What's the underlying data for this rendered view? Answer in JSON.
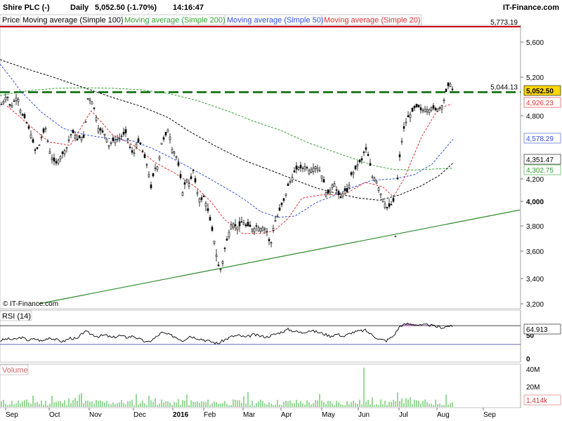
{
  "header": {
    "symbol": "Shire PLC (-)",
    "period": "Daily",
    "price_change": "5,052.50 (-1.70%)",
    "time": "14:16:47",
    "brand": "IT-Finance.com"
  },
  "legend": {
    "price": "Price",
    "ma100": "Moving average (Simple 100)",
    "ma200": "Moving average (Simple 200)",
    "ma50": "Moving average (Simple 50)",
    "ma20": "Moving average (Simple 20)"
  },
  "copyright": "© IT-Finance.com",
  "rsi_label": "RSI (14)",
  "volume_label": "Volume",
  "colors": {
    "up": "#000000",
    "down": "#000000",
    "ma20": "#e03030",
    "ma50": "#3050e0",
    "ma100": "#000000",
    "ma200": "#30a030",
    "resistance": "#cc0000",
    "support_dash": "#006600",
    "trend": "#2a8a2a",
    "rsi_line": "#000000",
    "rsi_fill": "#c080d0",
    "vol": "#30b030"
  },
  "chart_data": {
    "type": "candlestick",
    "x_tick_labels": [
      "Sep",
      "Oct",
      "Nov",
      "Dec",
      "2016",
      "Feb",
      "Mar",
      "Apr",
      "May",
      "Jun",
      "Jul",
      "Aug",
      "Sep"
    ],
    "price_axis_ticks": [
      "5,600",
      "5,200",
      "4,800",
      "4,200",
      "4,000",
      "3,800",
      "3,600",
      "3,400",
      "3,200"
    ],
    "price_range": [
      3180,
      5820
    ],
    "last_price": "5,052.50",
    "level_labels": {
      "high": "5,773.19",
      "dashed": "5,044.13",
      "ma20": "4,926.23",
      "ma50": "4,578.29",
      "ma100": "4,351.47",
      "ma200": "4,302.75"
    },
    "resistance": 5773.19,
    "dashed_level": 5044.13,
    "price_keypoints": [
      [
        0,
        4900
      ],
      [
        5,
        4950
      ],
      [
        10,
        5020
      ],
      [
        15,
        4880
      ],
      [
        20,
        4950
      ],
      [
        25,
        5010
      ],
      [
        30,
        4820
      ],
      [
        35,
        4780
      ],
      [
        40,
        4700
      ],
      [
        45,
        4600
      ],
      [
        50,
        4470
      ],
      [
        55,
        4500
      ],
      [
        60,
        4620
      ],
      [
        65,
        4680
      ],
      [
        70,
        4480
      ],
      [
        75,
        4380
      ],
      [
        80,
        4350
      ],
      [
        85,
        4400
      ],
      [
        90,
        4450
      ],
      [
        95,
        4500
      ],
      [
        100,
        4620
      ],
      [
        105,
        4640
      ],
      [
        110,
        4570
      ],
      [
        115,
        4600
      ],
      [
        120,
        4590
      ],
      [
        125,
        4980
      ],
      [
        130,
        4970
      ],
      [
        135,
        4850
      ],
      [
        140,
        4680
      ],
      [
        145,
        4650
      ],
      [
        150,
        4620
      ],
      [
        155,
        4520
      ],
      [
        160,
        4560
      ],
      [
        165,
        4570
      ],
      [
        170,
        4590
      ],
      [
        175,
        4620
      ],
      [
        180,
        4640
      ],
      [
        185,
        4500
      ],
      [
        190,
        4420
      ],
      [
        195,
        4560
      ],
      [
        200,
        4530
      ],
      [
        205,
        4420
      ],
      [
        210,
        4320
      ],
      [
        215,
        4120
      ],
      [
        220,
        4300
      ],
      [
        225,
        4320
      ],
      [
        230,
        4540
      ],
      [
        235,
        4600
      ],
      [
        240,
        4680
      ],
      [
        245,
        4480
      ],
      [
        250,
        4440
      ],
      [
        255,
        4300
      ],
      [
        260,
        4080
      ],
      [
        265,
        4200
      ],
      [
        270,
        4150
      ],
      [
        275,
        4280
      ],
      [
        280,
        4100
      ],
      [
        285,
        4000
      ],
      [
        290,
        4040
      ],
      [
        295,
        3950
      ],
      [
        300,
        3820
      ],
      [
        305,
        3680
      ],
      [
        310,
        3500
      ],
      [
        315,
        3460
      ],
      [
        320,
        3620
      ],
      [
        325,
        3730
      ],
      [
        330,
        3830
      ],
      [
        335,
        3800
      ],
      [
        340,
        3790
      ],
      [
        345,
        3840
      ],
      [
        350,
        3800
      ],
      [
        355,
        3800
      ],
      [
        360,
        3770
      ],
      [
        365,
        3800
      ],
      [
        370,
        3780
      ],
      [
        375,
        3790
      ],
      [
        380,
        3760
      ],
      [
        385,
        3630
      ],
      [
        390,
        3820
      ],
      [
        395,
        3880
      ],
      [
        400,
        3960
      ],
      [
        405,
        4020
      ],
      [
        410,
        4140
      ],
      [
        415,
        4200
      ],
      [
        420,
        4280
      ],
      [
        425,
        4310
      ],
      [
        430,
        4300
      ],
      [
        435,
        4320
      ],
      [
        440,
        4280
      ],
      [
        445,
        4300
      ],
      [
        450,
        4320
      ],
      [
        455,
        4280
      ],
      [
        460,
        4200
      ],
      [
        465,
        4050
      ],
      [
        470,
        4100
      ],
      [
        475,
        4180
      ],
      [
        480,
        4080
      ],
      [
        485,
        4030
      ],
      [
        490,
        4100
      ],
      [
        495,
        4080
      ],
      [
        500,
        4240
      ],
      [
        505,
        4280
      ],
      [
        510,
        4350
      ],
      [
        515,
        4380
      ],
      [
        520,
        4500
      ],
      [
        525,
        4400
      ],
      [
        530,
        4220
      ],
      [
        535,
        4200
      ],
      [
        540,
        4100
      ],
      [
        545,
        4020
      ],
      [
        550,
        3950
      ],
      [
        555,
        3960
      ],
      [
        560,
        4000
      ],
      [
        563,
        3720
      ],
      [
        566,
        4200
      ],
      [
        570,
        4480
      ],
      [
        575,
        4680
      ],
      [
        580,
        4780
      ],
      [
        585,
        4820
      ],
      [
        590,
        4880
      ],
      [
        595,
        4900
      ],
      [
        600,
        4850
      ],
      [
        605,
        4870
      ],
      [
        610,
        4860
      ],
      [
        615,
        4890
      ],
      [
        620,
        4860
      ],
      [
        625,
        4880
      ],
      [
        630,
        4910
      ],
      [
        635,
        5050
      ],
      [
        640,
        5150
      ],
      [
        645,
        5052
      ]
    ],
    "ma20_keypoints": [
      [
        10,
        4900
      ],
      [
        40,
        4720
      ],
      [
        70,
        4550
      ],
      [
        100,
        4520
      ],
      [
        130,
        4850
      ],
      [
        160,
        4620
      ],
      [
        190,
        4520
      ],
      [
        220,
        4360
      ],
      [
        250,
        4250
      ],
      [
        280,
        4120
      ],
      [
        300,
        4000
      ],
      [
        320,
        3850
      ],
      [
        345,
        3740
      ],
      [
        370,
        3740
      ],
      [
        390,
        3760
      ],
      [
        410,
        3860
      ],
      [
        430,
        4030
      ],
      [
        460,
        4060
      ],
      [
        490,
        4060
      ],
      [
        520,
        4170
      ],
      [
        545,
        4130
      ],
      [
        560,
        4040
      ],
      [
        575,
        4200
      ],
      [
        600,
        4600
      ],
      [
        625,
        4880
      ],
      [
        645,
        4926
      ]
    ],
    "ma50_keypoints": [
      [
        0,
        5350
      ],
      [
        30,
        5050
      ],
      [
        60,
        4830
      ],
      [
        90,
        4680
      ],
      [
        120,
        4620
      ],
      [
        160,
        4580
      ],
      [
        190,
        4560
      ],
      [
        220,
        4480
      ],
      [
        250,
        4380
      ],
      [
        280,
        4270
      ],
      [
        310,
        4160
      ],
      [
        340,
        4050
      ],
      [
        370,
        3920
      ],
      [
        395,
        3870
      ],
      [
        420,
        3880
      ],
      [
        450,
        3990
      ],
      [
        475,
        4050
      ],
      [
        500,
        4120
      ],
      [
        530,
        4190
      ],
      [
        560,
        4200
      ],
      [
        590,
        4240
      ],
      [
        615,
        4340
      ],
      [
        645,
        4578
      ]
    ],
    "ma100_keypoints": [
      [
        0,
        5400
      ],
      [
        40,
        5290
      ],
      [
        80,
        5190
      ],
      [
        120,
        5090
      ],
      [
        160,
        4990
      ],
      [
        200,
        4900
      ],
      [
        240,
        4780
      ],
      [
        270,
        4650
      ],
      [
        310,
        4500
      ],
      [
        350,
        4370
      ],
      [
        390,
        4270
      ],
      [
        420,
        4190
      ],
      [
        450,
        4120
      ],
      [
        480,
        4070
      ],
      [
        510,
        4030
      ],
      [
        540,
        4010
      ],
      [
        570,
        4060
      ],
      [
        600,
        4140
      ],
      [
        625,
        4230
      ],
      [
        645,
        4351
      ]
    ],
    "ma200_keypoints": [
      [
        0,
        5010
      ],
      [
        40,
        5060
      ],
      [
        80,
        5085
      ],
      [
        120,
        5090
      ],
      [
        160,
        5085
      ],
      [
        200,
        5070
      ],
      [
        240,
        5030
      ],
      [
        280,
        4960
      ],
      [
        320,
        4860
      ],
      [
        360,
        4750
      ],
      [
        400,
        4660
      ],
      [
        440,
        4540
      ],
      [
        470,
        4470
      ],
      [
        500,
        4400
      ],
      [
        530,
        4330
      ],
      [
        560,
        4290
      ],
      [
        590,
        4285
      ],
      [
        620,
        4295
      ],
      [
        645,
        4302
      ]
    ],
    "trendline": [
      [
        55,
        3200
      ],
      [
        740,
        3930
      ]
    ],
    "rsi": {
      "value": "64.913",
      "axis_ticks": [
        "0",
        "50"
      ],
      "upper": 70,
      "lower": 30,
      "keypoints": [
        [
          0,
          38
        ],
        [
          10,
          42
        ],
        [
          20,
          40
        ],
        [
          30,
          45
        ],
        [
          40,
          39
        ],
        [
          50,
          42
        ],
        [
          60,
          37
        ],
        [
          70,
          45
        ],
        [
          80,
          40
        ],
        [
          90,
          36
        ],
        [
          100,
          44
        ],
        [
          110,
          41
        ],
        [
          120,
          58
        ],
        [
          130,
          52
        ],
        [
          140,
          47
        ],
        [
          150,
          50
        ],
        [
          160,
          44
        ],
        [
          170,
          49
        ],
        [
          180,
          45
        ],
        [
          190,
          48
        ],
        [
          200,
          40
        ],
        [
          210,
          34
        ],
        [
          220,
          43
        ],
        [
          230,
          55
        ],
        [
          240,
          51
        ],
        [
          250,
          46
        ],
        [
          260,
          38
        ],
        [
          270,
          48
        ],
        [
          280,
          44
        ],
        [
          290,
          40
        ],
        [
          300,
          36
        ],
        [
          310,
          32
        ],
        [
          320,
          40
        ],
        [
          330,
          47
        ],
        [
          340,
          49
        ],
        [
          350,
          45
        ],
        [
          360,
          51
        ],
        [
          370,
          48
        ],
        [
          380,
          46
        ],
        [
          390,
          51
        ],
        [
          400,
          56
        ],
        [
          410,
          62
        ],
        [
          420,
          58
        ],
        [
          430,
          55
        ],
        [
          440,
          60
        ],
        [
          450,
          57
        ],
        [
          460,
          53
        ],
        [
          470,
          48
        ],
        [
          480,
          52
        ],
        [
          490,
          47
        ],
        [
          500,
          55
        ],
        [
          510,
          58
        ],
        [
          520,
          60
        ],
        [
          530,
          50
        ],
        [
          540,
          41
        ],
        [
          550,
          38
        ],
        [
          560,
          48
        ],
        [
          570,
          70
        ],
        [
          580,
          74
        ],
        [
          590,
          73
        ],
        [
          600,
          70
        ],
        [
          610,
          72
        ],
        [
          620,
          68
        ],
        [
          630,
          66
        ],
        [
          640,
          70
        ],
        [
          645,
          64.9
        ]
      ]
    },
    "volume": {
      "value": "1,414k",
      "axis_ticks": [
        "40M",
        "20M"
      ],
      "spike_index": 519
    }
  }
}
